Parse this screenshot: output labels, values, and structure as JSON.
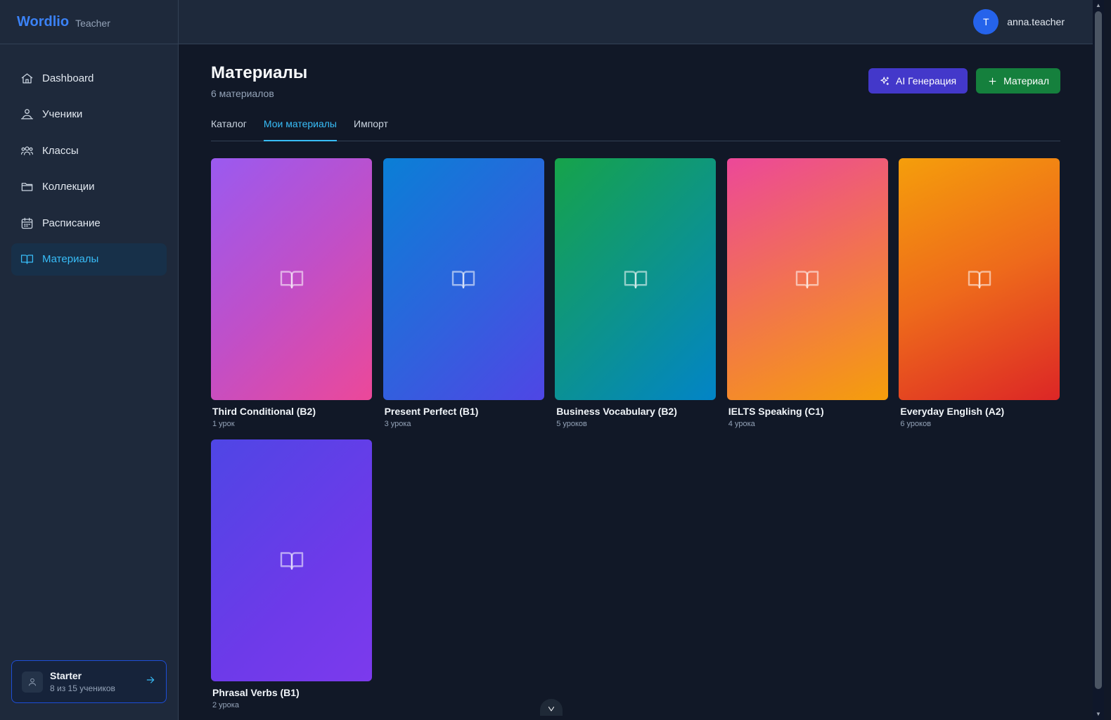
{
  "brand": {
    "name": "Wordlio",
    "role": "Teacher"
  },
  "user": {
    "initial": "T",
    "name": "anna.teacher"
  },
  "sidebar": {
    "items": [
      {
        "label": "Dashboard",
        "icon": "home-icon"
      },
      {
        "label": "Ученики",
        "icon": "students-icon"
      },
      {
        "label": "Классы",
        "icon": "classes-icon"
      },
      {
        "label": "Коллекции",
        "icon": "folder-icon"
      },
      {
        "label": "Расписание",
        "icon": "calendar-icon"
      },
      {
        "label": "Материалы",
        "icon": "book-icon",
        "active": true
      }
    ],
    "plan": {
      "name": "Starter",
      "usage": "8 из 15 учеников"
    }
  },
  "page": {
    "title": "Материалы",
    "subtitle": "6 материалов"
  },
  "actions": {
    "ai_label": "AI Генерация",
    "add_label": "Материал"
  },
  "tabs": [
    {
      "label": "Каталог"
    },
    {
      "label": "Мои материалы",
      "active": true
    },
    {
      "label": "Импорт"
    }
  ],
  "materials": [
    {
      "title": "Third Conditional (B2)",
      "count": "1 урок",
      "gradient": "purple-pink"
    },
    {
      "title": "Present Perfect (B1)",
      "count": "3 урока",
      "gradient": "blue-indigo"
    },
    {
      "title": "Business Vocabulary (B2)",
      "count": "5 уроков",
      "gradient": "green-cyan"
    },
    {
      "title": "IELTS Speaking (C1)",
      "count": "4 урока",
      "gradient": "pink-amber"
    },
    {
      "title": "Everyday English (A2)",
      "count": "6 уроков",
      "gradient": "amber-red"
    },
    {
      "title": "Phrasal Verbs (B1)",
      "count": "2 урока",
      "gradient": "indigo-violet"
    }
  ],
  "colors": {
    "accent": "#38bdf8",
    "brand": "#3b82f6",
    "ai_button": "#4338ca",
    "add_button": "#15803d"
  }
}
